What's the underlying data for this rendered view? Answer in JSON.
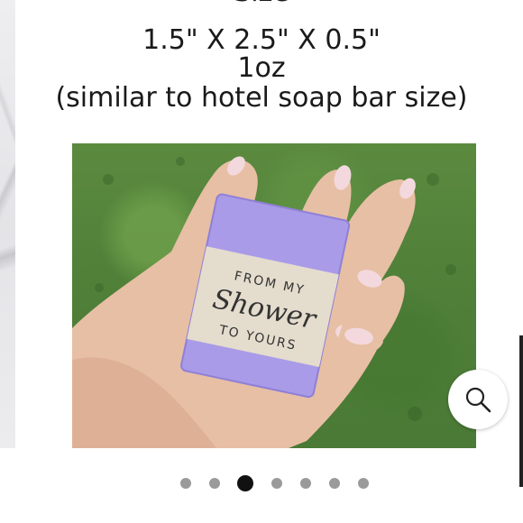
{
  "product": {
    "cut_heading": "Size",
    "dimensions": "1.5\" X 2.5\" X 0.5\"",
    "weight": "1oz",
    "size_note": "(similar to hotel soap bar size)"
  },
  "photo": {
    "label_top": "FROM MY",
    "label_script": "Shower",
    "label_bottom": "TO YOURS"
  },
  "zoom": {
    "icon": "magnifier-icon"
  },
  "carousel": {
    "count": 7,
    "active_index": 2
  },
  "colors": {
    "accent": "#111111",
    "dot": "#9a9a9a",
    "soap": "#a99be8",
    "label": "#e4dccd"
  }
}
